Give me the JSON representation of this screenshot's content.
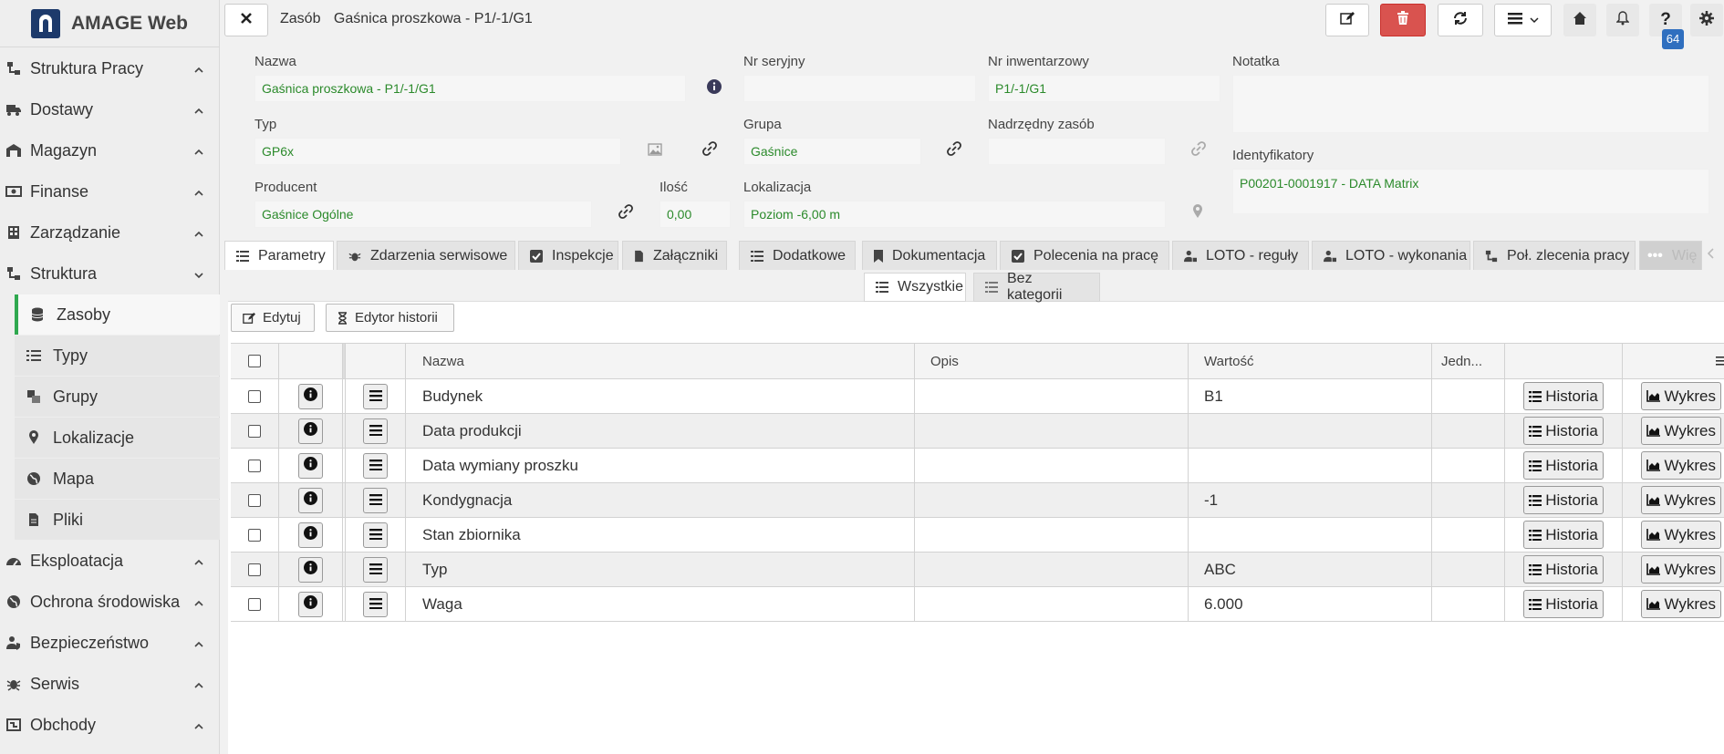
{
  "app": {
    "title": "AMAGE Web"
  },
  "sidebar": {
    "items": [
      {
        "label": "Struktura Pracy",
        "icon": "sitemap-icon"
      },
      {
        "label": "Dostawy",
        "icon": "truck-icon"
      },
      {
        "label": "Magazyn",
        "icon": "warehouse-icon"
      },
      {
        "label": "Finanse",
        "icon": "money-icon"
      },
      {
        "label": "Zarządzanie",
        "icon": "building-icon"
      },
      {
        "label": "Struktura",
        "icon": "sitemap-icon"
      }
    ],
    "subitems": [
      {
        "label": "Zasoby",
        "icon": "database-icon"
      },
      {
        "label": "Typy",
        "icon": "list-icon"
      },
      {
        "label": "Grupy",
        "icon": "group-icon"
      },
      {
        "label": "Lokalizacje",
        "icon": "pin-icon"
      },
      {
        "label": "Mapa",
        "icon": "globe-icon"
      },
      {
        "label": "Pliki",
        "icon": "file-icon"
      }
    ],
    "items_after": [
      {
        "label": "Eksploatacja",
        "icon": "gauge-icon"
      },
      {
        "label": "Ochrona środowiska",
        "icon": "globe-icon"
      },
      {
        "label": "Bezpieczeństwo",
        "icon": "user-shield-icon"
      },
      {
        "label": "Serwis",
        "icon": "bug-icon"
      },
      {
        "label": "Obchody",
        "icon": "route-icon"
      }
    ]
  },
  "header": {
    "breadcrumb_section": "Zasób",
    "breadcrumb_title": "Gaśnica proszkowa - P1/-1/G1",
    "notifications_count": "64"
  },
  "form": {
    "nazwa": {
      "label": "Nazwa",
      "value": "Gaśnica proszkowa - P1/-1/G1"
    },
    "nr_seryjny": {
      "label": "Nr seryjny",
      "value": ""
    },
    "nr_inwentarzowy": {
      "label": "Nr inwentarzowy",
      "value": "P1/-1/G1"
    },
    "notatka": {
      "label": "Notatka",
      "value": ""
    },
    "typ": {
      "label": "Typ",
      "value": "GP6x"
    },
    "grupa": {
      "label": "Grupa",
      "value": "Gaśnice"
    },
    "nadrzedny": {
      "label": "Nadrzędny zasób",
      "value": ""
    },
    "identyfikatory": {
      "label": "Identyfikatory",
      "value": "P00201-0001917 - DATA Matrix"
    },
    "producent": {
      "label": "Producent",
      "value": "Gaśnice Ogólne"
    },
    "ilosc": {
      "label": "Ilość",
      "value": "0,00"
    },
    "lokalizacja": {
      "label": "Lokalizacja",
      "value": "Poziom -6,00 m"
    }
  },
  "tabs": [
    {
      "label": "Parametry",
      "active": true
    },
    {
      "label": "Zdarzenia serwisowe"
    },
    {
      "label": "Inspekcje"
    },
    {
      "label": "Załączniki"
    },
    {
      "label": "Dodatkowe"
    },
    {
      "label": "Dokumentacja"
    },
    {
      "label": "Polecenia na pracę"
    },
    {
      "label": "LOTO - reguły"
    },
    {
      "label": "LOTO - wykonania"
    },
    {
      "label": "Poł. zlecenia pracy"
    },
    {
      "label": "Wię"
    }
  ],
  "subtabs": [
    {
      "label": "Wszystkie",
      "active": true
    },
    {
      "label": "Bez kategorii"
    }
  ],
  "actions": {
    "edit": "Edytuj",
    "history_editor": "Edytor historii"
  },
  "table": {
    "columns": {
      "nazwa": "Nazwa",
      "opis": "Opis",
      "wartosc": "Wartość",
      "jedn": "Jedn..."
    },
    "history_label": "Historia",
    "chart_label": "Wykres",
    "rows": [
      {
        "nazwa": "Budynek",
        "opis": "",
        "wartosc": "B1",
        "jedn": ""
      },
      {
        "nazwa": "Data produkcji",
        "opis": "",
        "wartosc": "",
        "jedn": ""
      },
      {
        "nazwa": "Data wymiany proszku",
        "opis": "",
        "wartosc": "",
        "jedn": ""
      },
      {
        "nazwa": "Kondygnacja",
        "opis": "",
        "wartosc": "-1",
        "jedn": ""
      },
      {
        "nazwa": "Stan zbiornika",
        "opis": "",
        "wartosc": "",
        "jedn": ""
      },
      {
        "nazwa": "Typ",
        "opis": "",
        "wartosc": "ABC",
        "jedn": ""
      },
      {
        "nazwa": "Waga",
        "opis": "",
        "wartosc": "6.000",
        "jedn": ""
      }
    ]
  },
  "colors": {
    "accent_green": "#2fa84f",
    "value_green": "#2b8a2b",
    "danger": "#d9534f",
    "brand": "#1d3a6b",
    "badge": "#2f6fbf"
  }
}
